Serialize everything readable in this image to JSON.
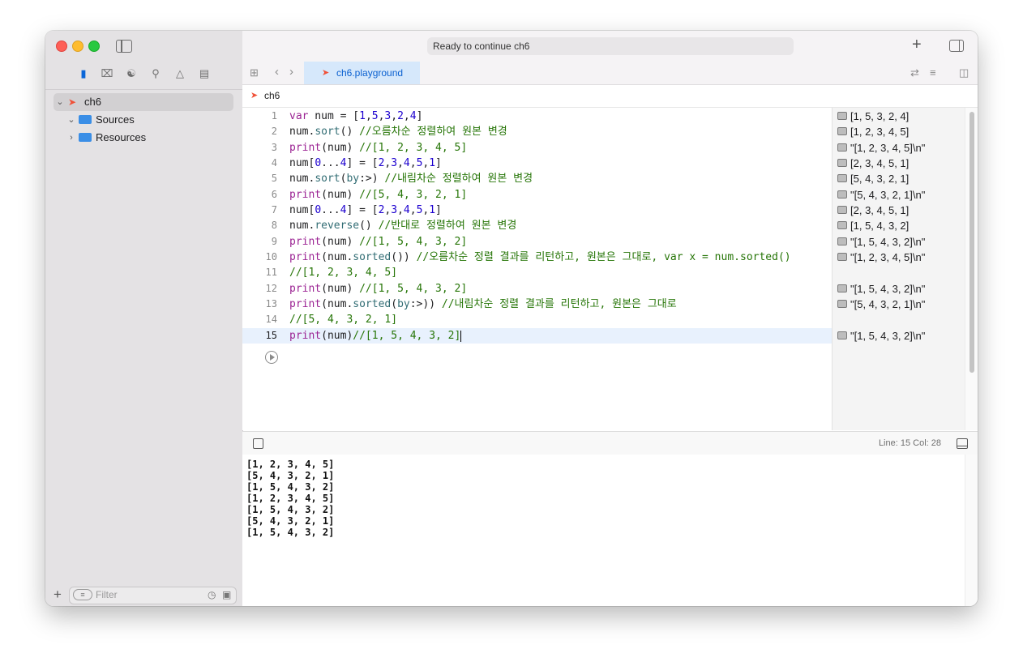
{
  "window": {
    "status": "Ready to continue ch6"
  },
  "navigator": {
    "tree": [
      {
        "label": "ch6",
        "expanded": true,
        "selected": true
      },
      {
        "label": "Sources",
        "expanded": true
      },
      {
        "label": "Resources",
        "expanded": false
      }
    ],
    "filter_placeholder": "Filter"
  },
  "editor": {
    "tab": "ch6.playground",
    "breadcrumb": "ch6",
    "current_line": 15,
    "lines": [
      {
        "no": "1",
        "code": "var num = [1,5,3,2,4]"
      },
      {
        "no": "2",
        "code": "num.sort() //오름차순 정렬하여 원본 변경"
      },
      {
        "no": "3",
        "code": "print(num) //[1, 2, 3, 4, 5]"
      },
      {
        "no": "4",
        "code": "num[0...4] = [2,3,4,5,1]"
      },
      {
        "no": "5",
        "code": "num.sort(by:>) //내림차순 정렬하여 원본 변경"
      },
      {
        "no": "6",
        "code": "print(num) //[5, 4, 3, 2, 1]"
      },
      {
        "no": "7",
        "code": "num[0...4] = [2,3,4,5,1]"
      },
      {
        "no": "8",
        "code": "num.reverse() //반대로 정렬하여 원본 변경"
      },
      {
        "no": "9",
        "code": "print(num) //[1, 5, 4, 3, 2]"
      },
      {
        "no": "10",
        "code": "print(num.sorted()) //오름차순 정렬 결과를 리턴하고, 원본은 그대로, var x = num.sorted()"
      },
      {
        "no": "11",
        "code": "//[1, 2, 3, 4, 5]"
      },
      {
        "no": "12",
        "code": "print(num) //[1, 5, 4, 3, 2]"
      },
      {
        "no": "13",
        "code": "print(num.sorted(by:>)) //내림차순 정렬 결과를 리턴하고, 원본은 그대로"
      },
      {
        "no": "14",
        "code": "//[5, 4, 3, 2, 1]"
      },
      {
        "no": "15",
        "code": "print(num)//[1, 5, 4, 3, 2]"
      }
    ]
  },
  "results": [
    {
      "line": 1,
      "text": "[1, 5, 3, 2, 4]"
    },
    {
      "line": 2,
      "text": "[1, 2, 3, 4, 5]"
    },
    {
      "line": 3,
      "text": "\"[1, 2, 3, 4, 5]\\n\""
    },
    {
      "line": 4,
      "text": "[2, 3, 4, 5, 1]"
    },
    {
      "line": 5,
      "text": "[5, 4, 3, 2, 1]"
    },
    {
      "line": 6,
      "text": "\"[5, 4, 3, 2, 1]\\n\""
    },
    {
      "line": 7,
      "text": "[2, 3, 4, 5, 1]"
    },
    {
      "line": 8,
      "text": "[1, 5, 4, 3, 2]"
    },
    {
      "line": 9,
      "text": "\"[1, 5, 4, 3, 2]\\n\""
    },
    {
      "line": 10,
      "text": "\"[1, 2, 3, 4, 5]\\n\""
    },
    {
      "line": 12,
      "text": "\"[1, 5, 4, 3, 2]\\n\""
    },
    {
      "line": 13,
      "text": "\"[5, 4, 3, 2, 1]\\n\""
    },
    {
      "line": 15,
      "text": "\"[1, 5, 4, 3, 2]\\n\""
    }
  ],
  "debug": {
    "position": "Line: 15  Col: 28"
  },
  "console": [
    "[1, 2, 3, 4, 5]",
    "[5, 4, 3, 2, 1]",
    "[1, 5, 4, 3, 2]",
    "[1, 2, 3, 4, 5]",
    "[1, 5, 4, 3, 2]",
    "[5, 4, 3, 2, 1]",
    "[1, 5, 4, 3, 2]"
  ],
  "colors": {
    "keyword": "#9b2393",
    "function": "#326d74",
    "number": "#1c00cf",
    "comment": "#267507",
    "accent": "#0a60d0",
    "swift": "#f05138"
  },
  "icons": [
    "sidebar-toggle-icon",
    "folder-icon",
    "source-control-icon",
    "hierarchy-icon",
    "search-icon",
    "warning-icon",
    "list-icon",
    "plus-icon",
    "inspector-icon",
    "grid-icon",
    "back-icon",
    "forward-icon",
    "swift-icon",
    "run-icon",
    "filter-icon",
    "clock-icon"
  ]
}
